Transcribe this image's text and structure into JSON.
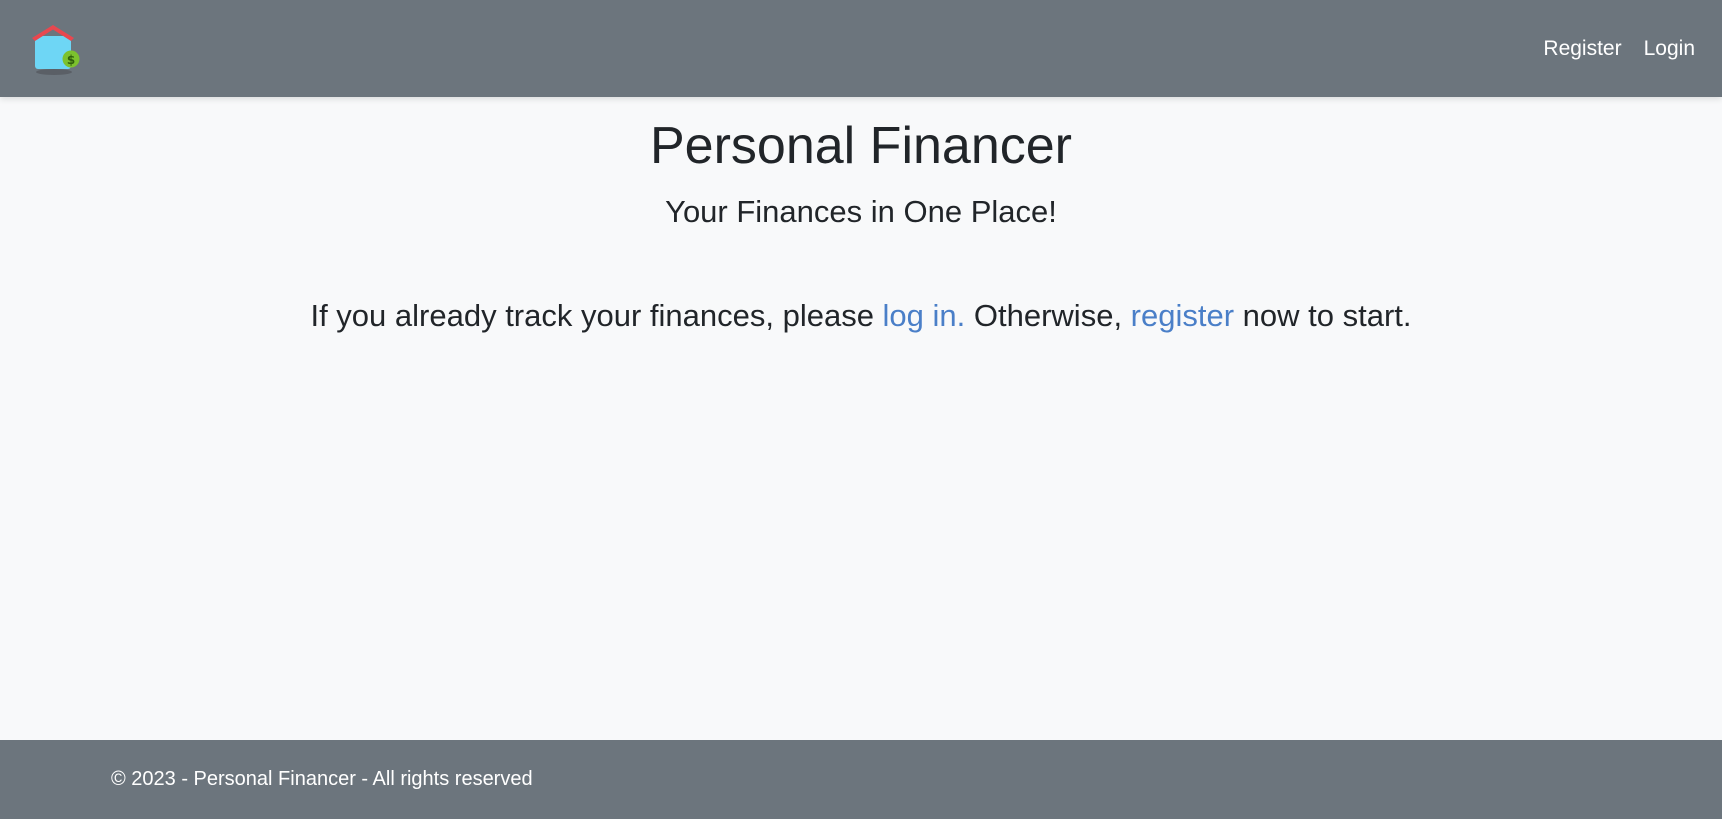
{
  "navbar": {
    "logo_icon": "house-with-dollar-icon",
    "links": [
      {
        "label": "Register"
      },
      {
        "label": "Login"
      }
    ]
  },
  "main": {
    "title": "Personal Financer",
    "tagline": "Your Finances in One Place!",
    "intro": {
      "prefix": "If you already track your finances, please ",
      "login_link": "log in.",
      "middle": " Otherwise, ",
      "register_link": "register",
      "suffix": " now to start."
    }
  },
  "footer": {
    "text": "© 2023 - Personal Financer - All rights reserved"
  },
  "colors": {
    "navbar_bg": "#6c757d",
    "page_bg": "#f8f9fa",
    "link": "#4a7fc8"
  }
}
